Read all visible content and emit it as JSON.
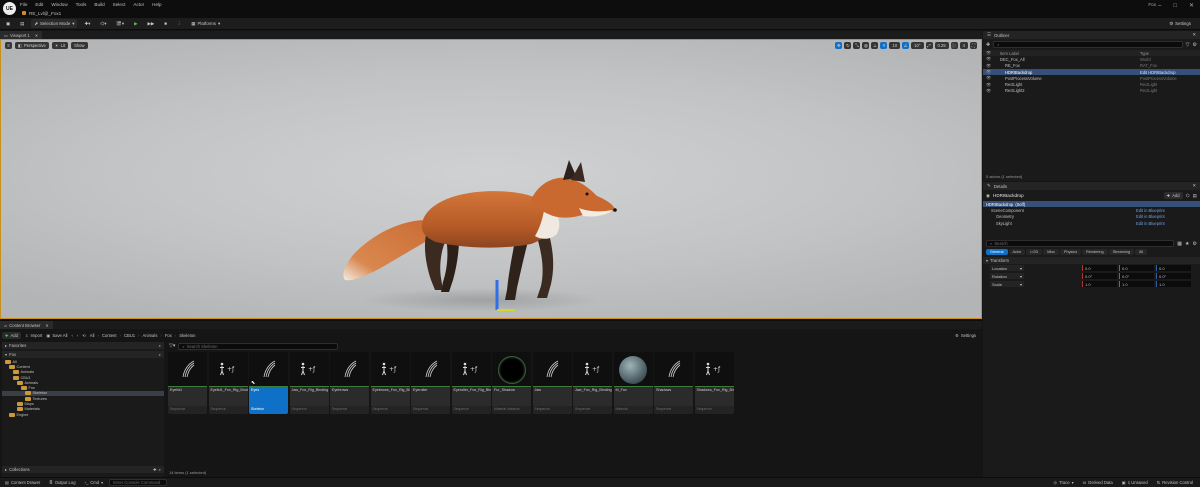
{
  "menu": {
    "logo": "UE",
    "items": [
      "File",
      "Edit",
      "Window",
      "Tools",
      "Build",
      "Select",
      "Actor",
      "Help"
    ],
    "level_tab": "RE_Lvl@_Fox1",
    "project": "Fox"
  },
  "toolbar": {
    "selection_mode": "Selection Mode",
    "platforms": "Platforms",
    "settings": "Settings"
  },
  "viewport": {
    "tab": "Viewport 1",
    "perspective": "Perspective",
    "lit": "Lit",
    "show": "Show",
    "snap_value": "10",
    "rot_value": "10°",
    "scale_value": "0.25",
    "cam_speed": "4"
  },
  "outliner": {
    "tab": "Outliner",
    "col_label": "Item Label",
    "col_type": "Type",
    "rows": [
      {
        "label": "DEC_Fox_All",
        "type": "World",
        "indent": 0,
        "selected": false,
        "visible": true
      },
      {
        "label": "RE_Fox",
        "type": "RAT_Fox",
        "indent": 1,
        "selected": false,
        "visible": true
      },
      {
        "label": "HDRIBackdrop",
        "type": "Edit HDRIBackdrop",
        "indent": 1,
        "selected": true,
        "visible": true
      },
      {
        "label": "PostProcessVolume",
        "type": "PostProcessVolume",
        "indent": 1,
        "selected": false,
        "visible": true
      },
      {
        "label": "RectLight",
        "type": "RectLight",
        "indent": 1,
        "selected": false,
        "visible": true
      },
      {
        "label": "RectLight2",
        "type": "RectLight",
        "indent": 1,
        "selected": false,
        "visible": true
      }
    ],
    "footer": "5 actors (1 selected)"
  },
  "details": {
    "tab": "Details",
    "actor": "HDRIBackdrop",
    "actor_suffix": "(Self)",
    "add_button": "Add",
    "components": [
      {
        "name": "SceneComponent",
        "type": "Edit in Blueprint",
        "indent": 1
      },
      {
        "name": "Geometry",
        "type": "Edit in Blueprint",
        "indent": 2
      },
      {
        "name": "SkyLight",
        "type": "Edit in Blueprint",
        "indent": 2
      }
    ],
    "search_placeholder": "Search",
    "tabs": [
      "General",
      "Actor",
      "LOD",
      "Misc",
      "Physics",
      "Rendering",
      "Streaming",
      "All"
    ],
    "section": "Transform",
    "transform": [
      {
        "label": "Location",
        "values": [
          "0.0",
          "0.0",
          "0.0"
        ]
      },
      {
        "label": "Rotation",
        "values": [
          "0.0°",
          "0.0°",
          "0.0°"
        ]
      },
      {
        "label": "Scale",
        "values": [
          "1.0",
          "1.0",
          "1.0"
        ]
      }
    ]
  },
  "content_browser": {
    "tab": "Content Browser",
    "add": "Add",
    "import": "Import",
    "save_all": "Save All",
    "breadcrumb": [
      "All",
      "Content",
      "CBU1",
      "Animals",
      "Fox",
      "Skeleton"
    ],
    "settings": "Settings",
    "search_placeholder": "Search Skeleton",
    "favorites": "Favorites",
    "root": "Fox",
    "collections": "Collections",
    "count": "14 items (1 selected)",
    "tree": [
      {
        "label": "All",
        "indent": 0,
        "selected": false
      },
      {
        "label": "Content",
        "indent": 1,
        "selected": false
      },
      {
        "label": "Animals",
        "indent": 2,
        "selected": false
      },
      {
        "label": "CBU1",
        "indent": 2,
        "selected": false
      },
      {
        "label": "Animals",
        "indent": 3,
        "selected": false
      },
      {
        "label": "Fox",
        "indent": 4,
        "selected": false
      },
      {
        "label": "Skeleton",
        "indent": 5,
        "selected": true
      },
      {
        "label": "Textures",
        "indent": 5,
        "selected": false
      },
      {
        "label": "Maps",
        "indent": 3,
        "selected": false
      },
      {
        "label": "Materials",
        "indent": 3,
        "selected": false
      },
      {
        "label": "Engine",
        "indent": 1,
        "selected": false
      }
    ],
    "assets": [
      {
        "name": "Eyelid1",
        "type": "Sequence",
        "kind": "curve"
      },
      {
        "name": "Eyelid1_Fox_Rig_Binding",
        "type": "Sequence",
        "kind": "rig"
      },
      {
        "name": "Eyes",
        "type": "Skeleton",
        "kind": "curve",
        "selected": true
      },
      {
        "name": "Jaw_Fox_Rig_Binding",
        "type": "Sequence",
        "kind": "rig"
      },
      {
        "name": "Eyebrows",
        "type": "Sequence",
        "kind": "curve"
      },
      {
        "name": "Eyebrows_Fox_Rig_Binding",
        "type": "Sequence",
        "kind": "rig"
      },
      {
        "name": "Eyeroller",
        "type": "Sequence",
        "kind": "curve"
      },
      {
        "name": "Eyeroller_Fox_Rig_Binding",
        "type": "Sequence",
        "kind": "rig"
      },
      {
        "name": "Fur_Shadow",
        "type": "Material Instance",
        "kind": "black_sphere"
      },
      {
        "name": "Jaw",
        "type": "Sequence",
        "kind": "curve"
      },
      {
        "name": "Jaw_Fox_Rig_Binding",
        "type": "Sequence",
        "kind": "rig"
      },
      {
        "name": "M_Fox",
        "type": "Material",
        "kind": "grey_sphere"
      },
      {
        "name": "Shadows",
        "type": "Sequence",
        "kind": "curve"
      },
      {
        "name": "Shadows_Fox_Rig_Binding",
        "type": "Sequence",
        "kind": "rig"
      }
    ]
  },
  "status": {
    "content_drawer": "Content Drawer",
    "output_log": "Output Log",
    "cmd": "Cmd",
    "console_placeholder": "Enter Console Command",
    "trace": "Trace",
    "derived_data": "Derived Data",
    "unsaved": "1 Unsaved",
    "revision_control": "Revision Control"
  },
  "colors": {
    "accent_blue": "#0e70c7",
    "viewport_border": "#c98f1d",
    "folder": "#c99a3a",
    "play_green": "#5ac45a"
  }
}
